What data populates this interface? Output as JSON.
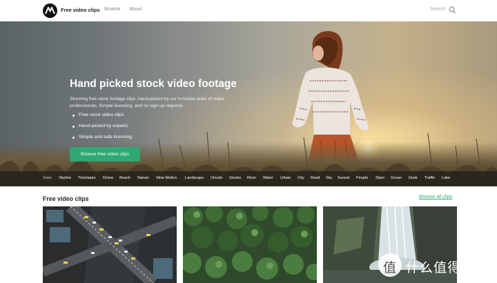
{
  "header": {
    "brand": "Free video clips",
    "nav": [
      "Browse",
      "About"
    ],
    "search_placeholder": "Search"
  },
  "hero": {
    "title": "Hand picked stock video footage",
    "description": "Stunning free stock footage clips, hand-picked by our in-house team of video professionals. Simple licensing, and no sign-up required.",
    "features": [
      "Free stock video clips",
      "Hand-picked by experts",
      "Simple and safe licensing"
    ],
    "cta_label": "Browse free video clips"
  },
  "tags": {
    "active_index": 0,
    "items": [
      "Stats",
      "Skyline",
      "Timelapse",
      "Drone",
      "Beach",
      "Nature",
      "Slow Motion",
      "Landscape",
      "Clouds",
      "Smoke",
      "River",
      "Water",
      "Urban",
      "City",
      "Road",
      "Sky",
      "Sunset",
      "People",
      "Stars",
      "Ocean",
      "Dusk",
      "Traffic",
      "Lake"
    ]
  },
  "section": {
    "title": "Free video clips",
    "browse_all": "Browse all clips",
    "thumbnails": [
      {
        "subject": "aerial-city-intersection-at-night"
      },
      {
        "subject": "aerial-pine-forest"
      },
      {
        "subject": "waterfall"
      }
    ]
  },
  "watermark": {
    "text": "什么值得买",
    "logo_char": "值"
  },
  "colors": {
    "accent": "#2fa974",
    "tag_bar": "#191919"
  }
}
